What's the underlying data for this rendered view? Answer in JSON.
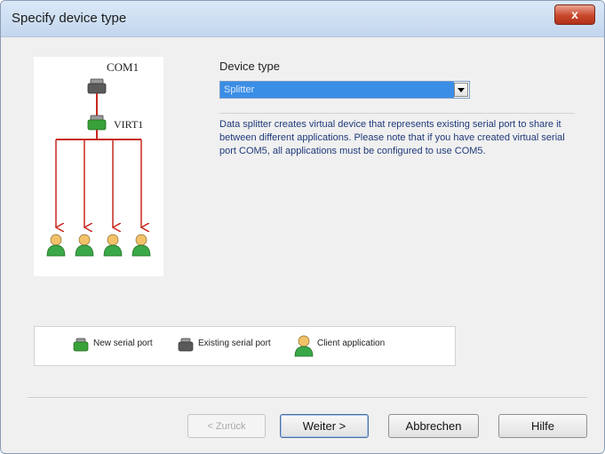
{
  "window": {
    "title": "Specify device type",
    "close_label": "x"
  },
  "diagram": {
    "com_label": "COM1",
    "virt_label": "VIRT1"
  },
  "device_type": {
    "label": "Device type",
    "selected": "Splitter"
  },
  "description": "Data splitter creates virtual device that represents existing serial port to share it between different applications. Please note that if you have created virtual serial port COM5, all applications must be configured to use COM5.",
  "legend": [
    {
      "label": "New serial port",
      "icon": "green-port-icon"
    },
    {
      "label": "Existing serial port",
      "icon": "gray-port-icon"
    },
    {
      "label": "Client application",
      "icon": "user-icon"
    }
  ],
  "buttons": {
    "back": "< Zurück",
    "next": "Weiter >",
    "cancel": "Abbrechen",
    "help": "Hilfe"
  },
  "colors": {
    "new_port": "#39a13a",
    "existing_port": "#5a5a5a",
    "arrow": "#c8281e",
    "selection": "#3a8ee6",
    "description_text": "#1f3a7a"
  }
}
